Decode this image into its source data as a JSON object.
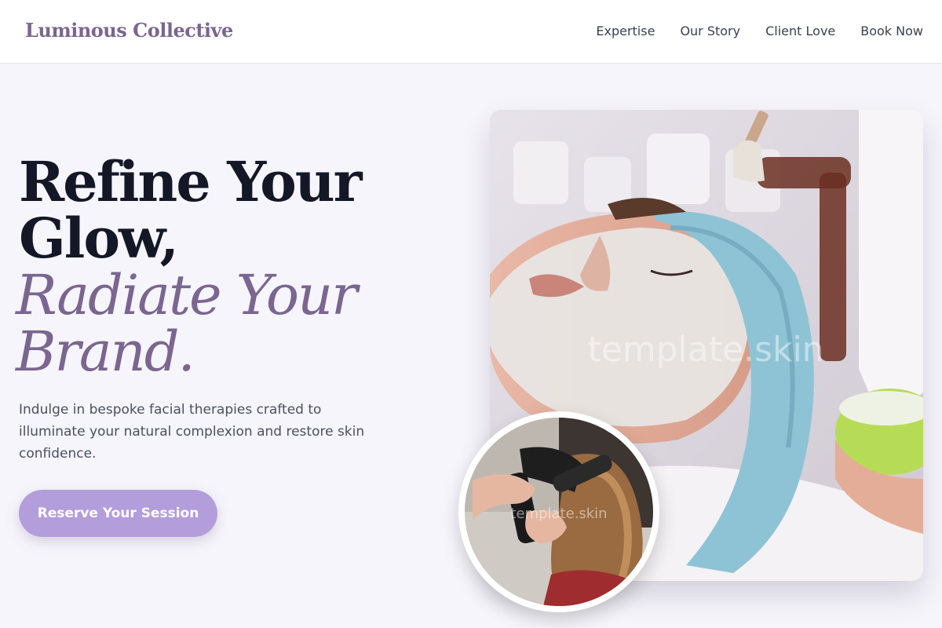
{
  "brand": {
    "name": "Luminous Collective"
  },
  "nav": {
    "items": [
      {
        "label": "Expertise"
      },
      {
        "label": "Our Story"
      },
      {
        "label": "Client Love"
      },
      {
        "label": "Book Now"
      }
    ]
  },
  "hero": {
    "title_line1": "Refine Your",
    "title_line2": "Glow,",
    "title_accent_line1": "Radiate Your",
    "title_accent_line2": "Brand.",
    "description": "Indulge in bespoke facial therapies crafted to illuminate your natural complexion and restore skin confidence.",
    "cta_label": "Reserve Your Session"
  },
  "images": {
    "main_watermark": "template.skin",
    "round_watermark": "template.skin"
  },
  "colors": {
    "accent": "#7a6690",
    "button": "#b39ddb",
    "background": "#f6f5fb",
    "heading": "#141826"
  }
}
